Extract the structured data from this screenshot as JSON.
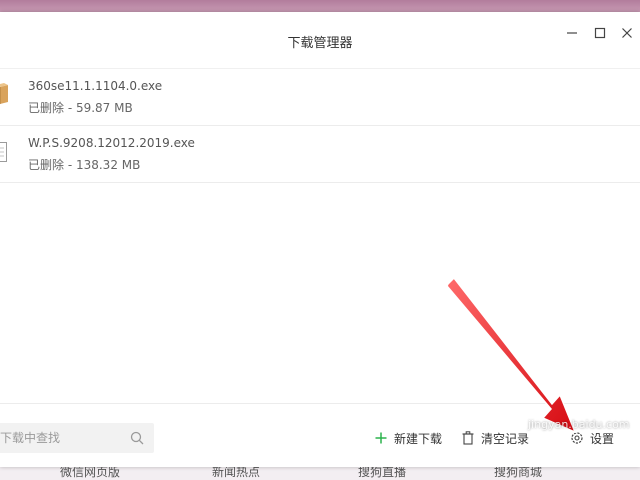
{
  "window": {
    "title": "下载管理器"
  },
  "files": [
    {
      "name": "360se11.1.1104.0.exe",
      "status": "已删除 - 59.87 MB",
      "icon": "package-icon"
    },
    {
      "name": "W.P.S.9208.12012.2019.exe",
      "status": "已删除 - 138.32 MB",
      "icon": "file-icon"
    }
  ],
  "search": {
    "placeholder": "下载中查找"
  },
  "actions": {
    "new_download": "新建下载",
    "clear_records": "清空记录",
    "settings": "设置"
  },
  "background_tabs": [
    "微信网页版",
    "新闻热点",
    "搜狗直播",
    "搜狗商城"
  ],
  "watermark": "jingyan.baidu.com",
  "colors": {
    "accent_green": "#2bb24c",
    "arrow_red": "#e8141b",
    "top_strip": "#b27d9c"
  }
}
